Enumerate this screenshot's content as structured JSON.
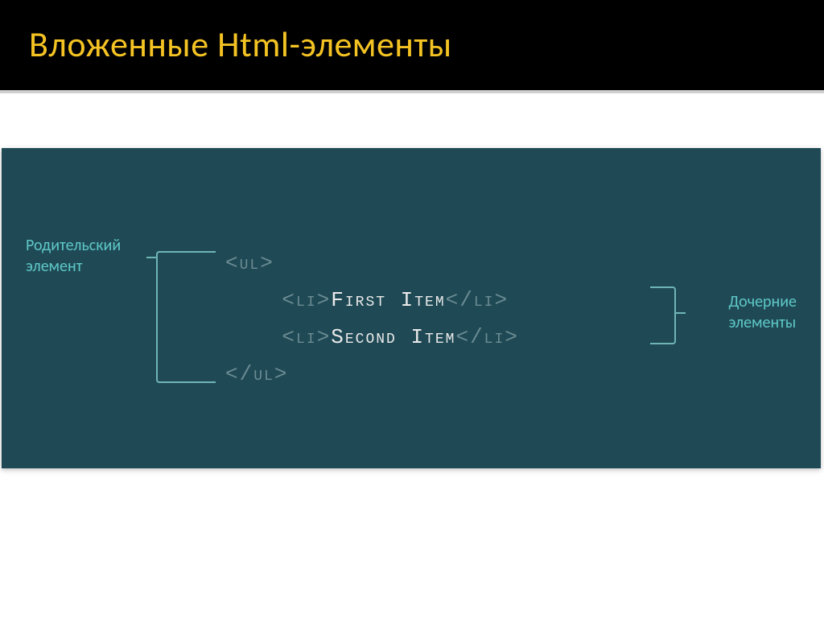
{
  "title": "Вложенные Html-элементы",
  "labels": {
    "parent_line1": "Родительский",
    "parent_line2": "элемент",
    "children_line1": "Дочерние",
    "children_line2": "элементы"
  },
  "code": {
    "ul_open": "<ul>",
    "li_open": "<li>",
    "item1": "First Item",
    "li_close": "</li>",
    "item2": "Second Item",
    "ul_close": "</ul>"
  }
}
